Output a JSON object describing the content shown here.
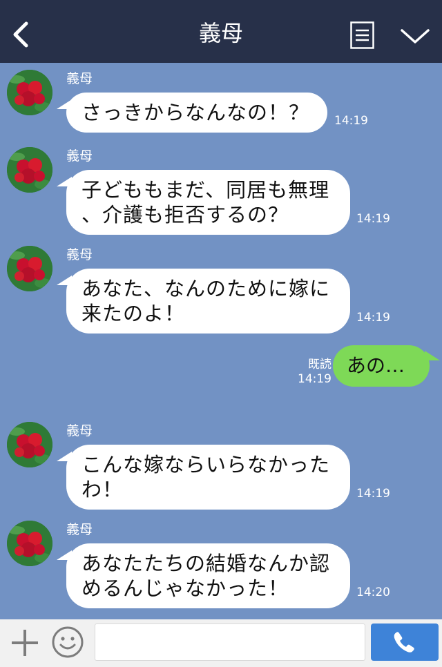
{
  "header": {
    "title": "義母",
    "icons": [
      "back-chevron-icon",
      "menu-list-icon",
      "chevron-down-icon"
    ]
  },
  "messages": [
    {
      "sender": "義母",
      "lines": [
        "さっきからなんなの！？"
      ],
      "time": "14:19"
    },
    {
      "sender": "義母",
      "lines": [
        "子どももまだ、同居も無理",
        "、介護も拒否するの？"
      ],
      "time": "14:19"
    },
    {
      "sender": "義母",
      "lines": [
        "あなた、なんのために嫁に",
        "来たのよ！"
      ],
      "time": "14:19"
    },
    {
      "sender": "義母",
      "lines": [
        "こんな嫁ならいらなかった",
        "わ！"
      ],
      "time": "14:19"
    },
    {
      "sender": "義母",
      "lines": [
        "あなたたちの結婚なんか認",
        "めるんじゃなかった！"
      ],
      "time": "14:20"
    }
  ],
  "my_message": {
    "text": "あの…",
    "read_label": "既読",
    "time": "14:19"
  },
  "footer": {
    "icons": [
      "plus-icon",
      "smiley-icon",
      "phone-icon"
    ],
    "input_placeholder": ""
  },
  "colors": {
    "header_bg": "#273049",
    "chat_bg": "#7292c4",
    "my_bubble": "#7ed957",
    "their_bubble": "#ffffff",
    "call_button": "#3e83d8"
  }
}
